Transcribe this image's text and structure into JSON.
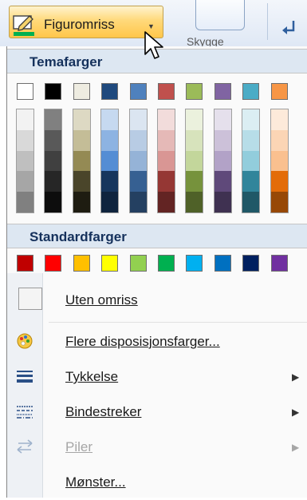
{
  "ribbon": {
    "button_label": "Figuromriss",
    "neighbor_caption": "Skygge"
  },
  "menu": {
    "theme_colors_title": "Temafarger",
    "theme_colors": [
      "#ffffff",
      "#000000",
      "#eeece1",
      "#1f497d",
      "#4f81bd",
      "#c0504d",
      "#9bbb59",
      "#8064a2",
      "#4bacc6",
      "#f79646"
    ],
    "theme_shades": [
      [
        "#f2f2f2",
        "#d9d9d9",
        "#bfbfbf",
        "#a6a6a6",
        "#808080"
      ],
      [
        "#808080",
        "#595959",
        "#404040",
        "#262626",
        "#0d0d0d"
      ],
      [
        "#ddd9c3",
        "#c4bd97",
        "#948a54",
        "#4a452a",
        "#1e1c11"
      ],
      [
        "#c6d9f0",
        "#8db3e2",
        "#548dd4",
        "#17365d",
        "#0f243e"
      ],
      [
        "#dbe5f1",
        "#b8cce4",
        "#95b3d7",
        "#366092",
        "#244061"
      ],
      [
        "#f2dcdb",
        "#e5b9b7",
        "#d99694",
        "#953734",
        "#632423"
      ],
      [
        "#ebf1dd",
        "#d7e3bc",
        "#c3d69b",
        "#76923c",
        "#4f6128"
      ],
      [
        "#e5e0ec",
        "#ccc1d9",
        "#b2a2c7",
        "#5f497a",
        "#3f3151"
      ],
      [
        "#dbeef3",
        "#b7dde8",
        "#92cddc",
        "#31859b",
        "#205867"
      ],
      [
        "#fdeada",
        "#fbd5b5",
        "#fac08f",
        "#e36c09",
        "#974806"
      ]
    ],
    "standard_colors_title": "Standardfarger",
    "standard_colors": [
      "#c00000",
      "#ff0000",
      "#ffc000",
      "#ffff00",
      "#92d050",
      "#00b050",
      "#00b0f0",
      "#0070c0",
      "#002060",
      "#7030a0"
    ],
    "items": [
      {
        "label": "Uten omriss",
        "icon": "no-outline-icon"
      },
      {
        "label": "Flere disposisjonsfarger...",
        "icon": "color-palette-icon"
      },
      {
        "label": "Tykkelse",
        "icon": "line-weight-icon"
      },
      {
        "label": "Bindestreker",
        "icon": "dash-style-icon"
      },
      {
        "label": "Piler",
        "icon": "arrows-icon",
        "disabled": true
      },
      {
        "label": "Mønster...",
        "icon": "pattern-icon"
      }
    ]
  }
}
